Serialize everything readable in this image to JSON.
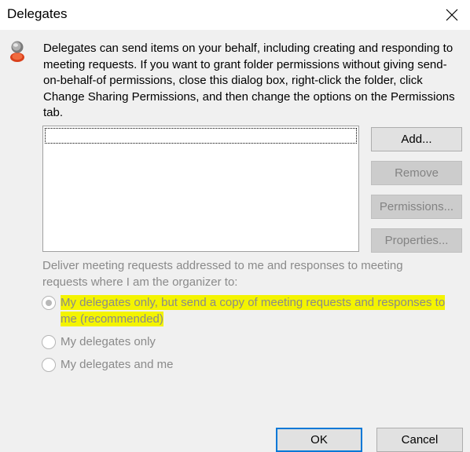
{
  "window": {
    "title": "Delegates",
    "close_icon": "close-icon"
  },
  "intro": {
    "icon": "delegates-person-icon",
    "text": "Delegates can send items on your behalf, including creating and responding to meeting requests. If you want to grant folder permissions without giving send-on-behalf-of permissions, close this dialog box, right-click the folder, click Change Sharing Permissions, and then change the options on the Permissions tab."
  },
  "delegates_list": {
    "items": []
  },
  "side_buttons": {
    "add": "Add...",
    "remove": "Remove",
    "permissions": "Permissions...",
    "properties": "Properties..."
  },
  "delivery": {
    "label": "Deliver meeting requests addressed to me and responses to meeting requests where I am the organizer to:",
    "options": [
      {
        "label": "My delegates only, but send a copy of meeting requests and responses to me (recommended)",
        "selected": true,
        "highlighted": true,
        "highlight_color": "#f4f400"
      },
      {
        "label": "My delegates only",
        "selected": false
      },
      {
        "label": "My delegates and me",
        "selected": false
      }
    ]
  },
  "footer": {
    "ok": "OK",
    "cancel": "Cancel"
  },
  "colors": {
    "accent": "#0078d7",
    "disabled_text": "#838383",
    "background": "#f0f0f0"
  }
}
